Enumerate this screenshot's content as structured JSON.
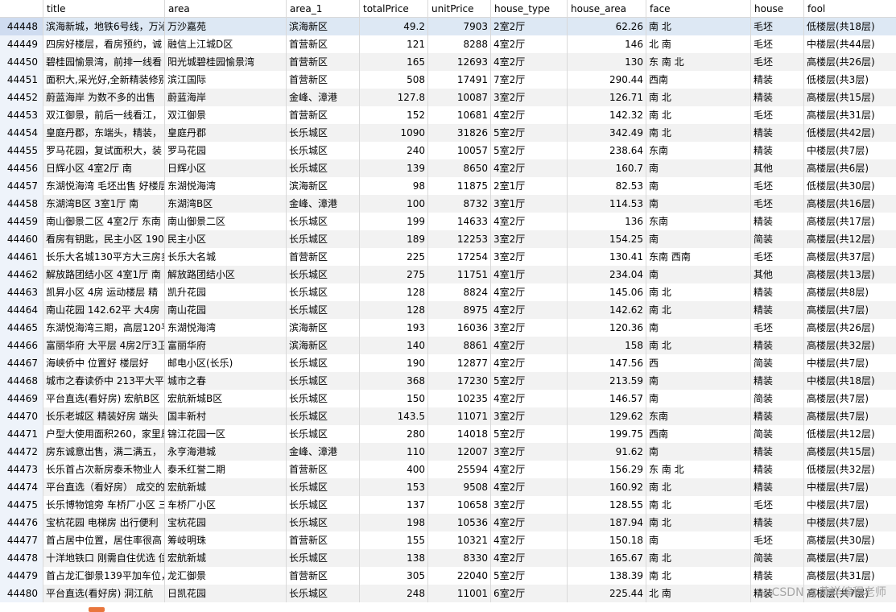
{
  "columns": [
    "",
    "title",
    "area",
    "area_1",
    "totalPrice",
    "unitPrice",
    "house_type",
    "house_area",
    "face",
    "house",
    "fool"
  ],
  "rows": [
    [
      "44448",
      "滨海新城，地铁6号线，万沁",
      "万沙嘉苑",
      "滨海新区",
      "49.2",
      "7903",
      "2室2厅",
      "62.26",
      "南 北",
      "毛坯",
      "低楼层(共18层)"
    ],
    [
      "44449",
      "四房好楼层，看房预约，诚",
      "融信上江城D区",
      "首营新区",
      "121",
      "8288",
      "4室2厅",
      "146",
      "北 南",
      "毛坯",
      "中楼层(共44层)"
    ],
    [
      "44450",
      "碧桂园愉景湾，前排一线看",
      "阳光城碧桂园愉景湾",
      "首营新区",
      "165",
      "12693",
      "4室2厅",
      "130",
      "东 南 北",
      "毛坯",
      "高楼层(共26层)"
    ],
    [
      "44451",
      "面积大,采光好,全新精装修别",
      "滨江国际",
      "首营新区",
      "508",
      "17491",
      "7室2厅",
      "290.44",
      "西南",
      "精装",
      "低楼层(共3层)"
    ],
    [
      "44452",
      "蔚蓝海岸 为数不多的出售",
      "蔚蓝海岸",
      "金峰、漳港",
      "127.8",
      "10087",
      "3室2厅",
      "126.71",
      "南 北",
      "精装",
      "高楼层(共15层)"
    ],
    [
      "44453",
      "双江御景，前后一线看江，",
      "双江御景",
      "首营新区",
      "152",
      "10681",
      "4室2厅",
      "142.32",
      "南 北",
      "毛坯",
      "高楼层(共31层)"
    ],
    [
      "44454",
      "皇庭丹郡，东端头，精装，",
      "皇庭丹郡",
      "长乐城区",
      "1090",
      "31826",
      "5室2厅",
      "342.49",
      "南 北",
      "精装",
      "低楼层(共42层)"
    ],
    [
      "44455",
      "罗马花园，复试面积大，装",
      "罗马花园",
      "长乐城区",
      "240",
      "10057",
      "5室2厅",
      "238.64",
      "东南",
      "精装",
      "中楼层(共7层)"
    ],
    [
      "44456",
      "日辉小区 4室2厅 南",
      "日辉小区",
      "长乐城区",
      "139",
      "8650",
      "4室2厅",
      "160.7",
      "南",
      "其他",
      "高楼层(共6层)"
    ],
    [
      "44457",
      "东湖悦海湾 毛坯出售 好楼层",
      "东湖悦海湾",
      "滨海新区",
      "98",
      "11875",
      "2室1厅",
      "82.53",
      "南",
      "毛坯",
      "低楼层(共30层)"
    ],
    [
      "44458",
      "东湖湾B区 3室1厅 南",
      "东湖湾B区",
      "金峰、漳港",
      "100",
      "8732",
      "3室1厅",
      "114.53",
      "南",
      "毛坯",
      "高楼层(共16层)"
    ],
    [
      "44459",
      "南山御景二区 4室2厅 东南",
      "南山御景二区",
      "长乐城区",
      "199",
      "14633",
      "4室2厅",
      "136",
      "东南",
      "精装",
      "高楼层(共17层)"
    ],
    [
      "44460",
      "看房有钥匙，民主小区 190",
      "民主小区",
      "长乐城区",
      "189",
      "12253",
      "3室2厅",
      "154.25",
      "南",
      "简装",
      "高楼层(共12层)"
    ],
    [
      "44461",
      "长乐大名城130平方大三房卖",
      "长乐大名城",
      "首营新区",
      "225",
      "17254",
      "3室2厅",
      "130.41",
      "东南 西南",
      "毛坯",
      "高楼层(共37层)"
    ],
    [
      "44462",
      "解放路团结小区 4室1厅 南",
      "解放路团结小区",
      "长乐城区",
      "275",
      "11751",
      "4室1厅",
      "234.04",
      "南",
      "其他",
      "高楼层(共13层)"
    ],
    [
      "44463",
      "凯昇小区 4房 运动楼层 精",
      "凯升花园",
      "长乐城区",
      "128",
      "8824",
      "4室2厅",
      "145.06",
      "南 北",
      "精装",
      "高楼层(共8层)"
    ],
    [
      "44464",
      "南山花园 142.62平 大4房",
      "南山花园",
      "长乐城区",
      "128",
      "8975",
      "4室2厅",
      "142.62",
      "南 北",
      "精装",
      "高楼层(共7层)"
    ],
    [
      "44465",
      "东湖悦海湾三期，高层120平",
      "东湖悦海湾",
      "滨海新区",
      "193",
      "16036",
      "3室2厅",
      "120.36",
      "南",
      "毛坯",
      "高楼层(共26层)"
    ],
    [
      "44466",
      "富丽华府 大平层 4房2厅3卫",
      "富丽华府",
      "滨海新区",
      "140",
      "8861",
      "4室2厅",
      "158",
      "南 北",
      "精装",
      "高楼层(共32层)"
    ],
    [
      "44467",
      "海峡侨中 位置好 楼层好 ",
      "邮电小区(长乐)",
      "长乐城区",
      "190",
      "12877",
      "4室2厅",
      "147.56",
      "西",
      "简装",
      "中楼层(共7层)"
    ],
    [
      "44468",
      "城市之春读侨中 213平大平",
      "城市之春",
      "长乐城区",
      "368",
      "17230",
      "5室2厅",
      "213.59",
      "南",
      "精装",
      "中楼层(共18层)"
    ],
    [
      "44469",
      "平台直选(看好房) 宏航B区",
      "宏航新城B区",
      "长乐城区",
      "150",
      "10235",
      "4室2厅",
      "146.57",
      "南",
      "简装",
      "高楼层(共7层)"
    ],
    [
      "44470",
      "长乐老城区 精装好房 端头",
      "国丰新村",
      "长乐城区",
      "143.5",
      "11071",
      "3室2厅",
      "129.62",
      "东南",
      "精装",
      "高楼层(共7层)"
    ],
    [
      "44471",
      "户型大使用面积260，家里居",
      "锦江花园一区",
      "长乐城区",
      "280",
      "14018",
      "5室2厅",
      "199.75",
      "西南",
      "简装",
      "低楼层(共12层)"
    ],
    [
      "44472",
      "房东诚意出售，满二满五，",
      "永亨海港城",
      "金峰、漳港",
      "110",
      "12007",
      "3室2厅",
      "91.62",
      "南",
      "精装",
      "高楼层(共15层)"
    ],
    [
      "44473",
      "长乐首占次新房泰禾物业人",
      "泰禾红誉二期",
      "首营新区",
      "400",
      "25594",
      "4室2厅",
      "156.29",
      "东 南 北",
      "精装",
      "低楼层(共32层)"
    ],
    [
      "44474",
      "平台直选（看好房） 成交的",
      "宏航新城",
      "长乐城区",
      "153",
      "9508",
      "4室2厅",
      "160.92",
      "南 北",
      "精装",
      "中楼层(共7层)"
    ],
    [
      "44475",
      "长乐博物馆旁 车桥厂小区 三",
      "车桥厂小区",
      "长乐城区",
      "137",
      "10658",
      "3室2厅",
      "128.55",
      "南 北",
      "毛坯",
      "中楼层(共7层)"
    ],
    [
      "44476",
      "宝杭花园 电梯房 出行便利",
      "宝杭花园",
      "长乐城区",
      "198",
      "10536",
      "4室2厅",
      "187.94",
      "南 北",
      "精装",
      "中楼层(共7层)"
    ],
    [
      "44477",
      "首占居中位置，居住率很高",
      "筹岐明珠",
      "首营新区",
      "155",
      "10321",
      "4室2厅",
      "150.18",
      "南",
      "毛坯",
      "高楼层(共30层)"
    ],
    [
      "44478",
      "十洋地铁口 刚需自住优选 位",
      "宏航新城",
      "长乐城区",
      "138",
      "8330",
      "4室2厅",
      "165.67",
      "南 北",
      "简装",
      "高楼层(共7层)"
    ],
    [
      "44479",
      "首占龙汇御景139平加车位，",
      "龙汇御景",
      "首营新区",
      "305",
      "22040",
      "5室2厅",
      "138.39",
      "南 北",
      "精装",
      "高楼层(共31层)"
    ],
    [
      "44480",
      "平台直选(看好房) 洞江航",
      "日凯花园",
      "长乐城区",
      "248",
      "11001",
      "6室2厅",
      "225.44",
      "北 南",
      "精装",
      "高楼层(共7层)"
    ]
  ],
  "watermark": "CSDN @黄洋编程老师"
}
